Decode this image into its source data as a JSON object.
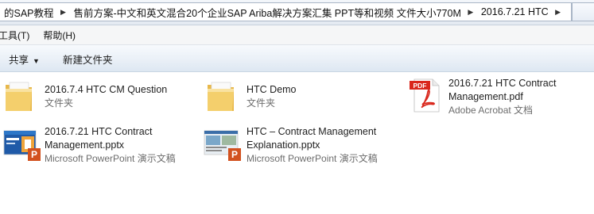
{
  "address_bar": {
    "crumbs": [
      "的SAP教程",
      "售前方案-中文和英文混合20个企业SAP Ariba解决方案汇集 PPT等和视频 文件大小770M",
      "2016.7.21 HTC"
    ]
  },
  "menu": {
    "items": [
      "工具(T)",
      "帮助(H)"
    ]
  },
  "toolbar": {
    "share_label": "共享",
    "new_folder_label": "新建文件夹"
  },
  "files": [
    {
      "name_line1": "2016.7.4 HTC CM Question",
      "name_line2": "",
      "type": "文件夹",
      "icon": "folder-icon"
    },
    {
      "name_line1": "HTC Demo",
      "name_line2": "",
      "type": "文件夹",
      "icon": "folder-icon"
    },
    {
      "name_line1": "2016.7.21 HTC Contract",
      "name_line2": "Management.pdf",
      "type": "Adobe Acrobat 文档",
      "icon": "pdf-file-icon",
      "icon_badge": "PDF"
    },
    {
      "name_line1": "2016.7.21 HTC Contract",
      "name_line2": "Management.pptx",
      "type": "Microsoft PowerPoint 演示文稿",
      "icon": "pptx-thumbnail-icon",
      "icon_badge": "P"
    },
    {
      "name_line1": "HTC – Contract Management",
      "name_line2": "Explanation.pptx",
      "type": "Microsoft PowerPoint 演示文稿",
      "icon": "pptx-thumbnail-icon",
      "icon_badge": "P"
    }
  ],
  "colors": {
    "pdf_red": "#d9271c",
    "ppt_orange": "#d2511f",
    "folder_yellow": "#f1c65c",
    "toolbar_blue": "#dde7f2"
  }
}
